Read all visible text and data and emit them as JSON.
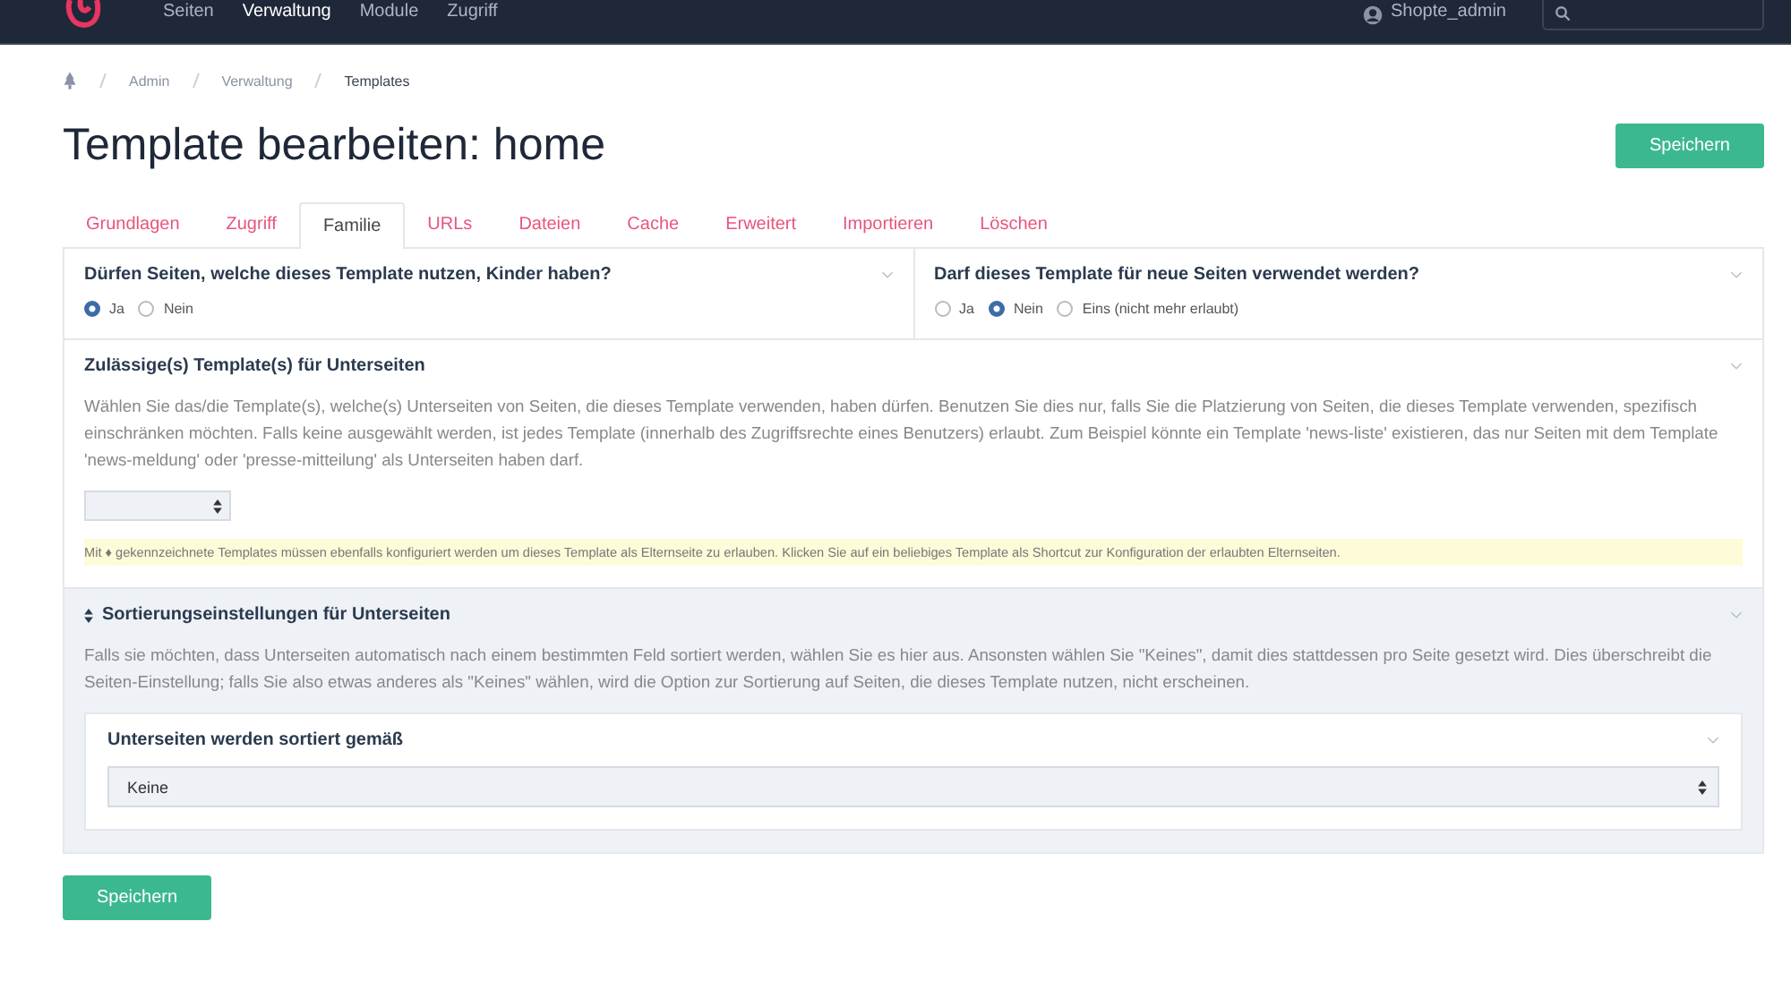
{
  "nav": {
    "items": [
      {
        "label": "Seiten",
        "selected": false
      },
      {
        "label": "Verwaltung",
        "selected": true
      },
      {
        "label": "Module",
        "selected": false
      },
      {
        "label": "Zugriff",
        "selected": false
      }
    ],
    "user": "Shopte_admin"
  },
  "breadcrumb": [
    "Admin",
    "Verwaltung",
    "Templates"
  ],
  "title": "Template bearbeiten: home",
  "save_top": "Speichern",
  "tabs": [
    {
      "label": "Grundlagen",
      "selected": false
    },
    {
      "label": "Zugriff",
      "selected": false
    },
    {
      "label": "Familie",
      "selected": true
    },
    {
      "label": "URLs",
      "selected": false
    },
    {
      "label": "Dateien",
      "selected": false
    },
    {
      "label": "Cache",
      "selected": false
    },
    {
      "label": "Erweitert",
      "selected": false
    },
    {
      "label": "Importieren",
      "selected": false
    },
    {
      "label": "Löschen",
      "selected": false
    }
  ],
  "questions": [
    {
      "label": "Dürfen Seiten, welche dieses Template nutzen, Kinder haben?",
      "options": [
        {
          "label": "Ja",
          "selected": true
        },
        {
          "label": "Nein",
          "selected": false
        }
      ]
    },
    {
      "label": "Darf dieses Template für neue Seiten verwendet werden?",
      "options": [
        {
          "label": "Ja",
          "selected": false
        },
        {
          "label": "Nein",
          "selected": true
        },
        {
          "label": "Eins (nicht mehr erlaubt)",
          "selected": false
        }
      ]
    }
  ],
  "allowed": {
    "label": "Zulässige(s) Template(s) für Unterseiten",
    "description": "Wählen Sie das/die Template(s), welche(s) Unterseiten von Seiten, die dieses Template verwenden, haben dürfen. Benutzen Sie dies nur, falls Sie die Platzierung von Seiten, die dieses Template verwenden, spezifisch einschränken möchten. Falls keine ausgewählt werden, ist jedes Template (innerhalb des Zugriffsrechte eines Benutzers) erlaubt. Zum Beispiel könnte ein Template 'news-liste' existieren, das nur Seiten mit dem Template 'news-meldung' oder 'presse-mitteilung' als Unterseiten haben darf.",
    "note": "Mit ♦ gekennzeichnete Templates müssen ebenfalls konfiguriert werden um dieses Template als Elternseite zu erlauben. Klicken Sie auf ein beliebiges Template als Shortcut zur Konfiguration der erlaubten Elternseiten."
  },
  "sorting": {
    "label": "Sortierungseinstellungen für Unterseiten",
    "description": "Falls sie möchten, dass Unterseiten automatisch nach einem bestimmten Feld sortiert werden, wählen Sie es hier aus. Ansonsten wählen Sie \"Keines\", damit dies stattdessen pro Seite gesetzt wird. Dies überschreibt die Seiten-Einstellung; falls Sie also etwas anderes als \"Keines\" wählen, wird die Option zur Sortierung auf Seiten, die dieses Template nutzen, nicht erscheinen.",
    "field_label": "Unterseiten werden sortiert gemäß",
    "value": "Keine"
  },
  "save_bottom": "Speichern"
}
